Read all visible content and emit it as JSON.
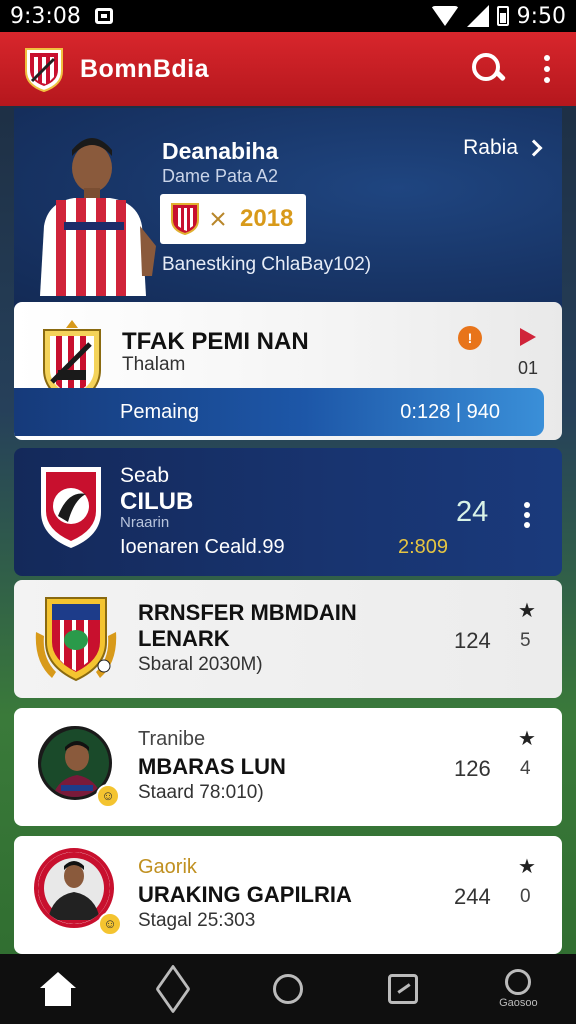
{
  "status_bar": {
    "time_left": "9:3:08",
    "time_right": "9:50"
  },
  "app_bar": {
    "title": "BomnBdia",
    "logo_icon": "club-crest-icon",
    "search_icon": "search-icon",
    "menu_icon": "more-vert-icon"
  },
  "hero": {
    "name": "Deanabiha",
    "subtitle": "Dame Pata A2",
    "badge_year": "2018",
    "stat": "Banestking ChlaBay102)",
    "link_label": "Rabia"
  },
  "cards": [
    {
      "title": "TFAK PEMI NAN",
      "subtitle": "Thalam",
      "bar_label": "Pemaing",
      "bar_value": "0:128 | 940",
      "num": "01"
    },
    {
      "line1": "Seab",
      "line2": "CILUB",
      "line3": "Nraarin",
      "line4": "Ioenaren Ceald.99",
      "num": "24",
      "value": "2:809"
    },
    {
      "line1": "RRNSFER MBMDAIN",
      "line2": "LENARK",
      "foot": "Sbaral 2030M)",
      "num": "124",
      "sec": "5"
    },
    {
      "pre": "Tranibe",
      "main": "MBARAS LUN",
      "foot": "Staard 78:010)",
      "num": "126",
      "sec": "4"
    },
    {
      "pre": "Gaorik",
      "main": "URAKING GAPILRIA",
      "foot": "Stagal 25:303",
      "num": "244",
      "sec": "0"
    }
  ],
  "nav": {
    "items": [
      {
        "icon": "home-icon"
      },
      {
        "icon": "back-triangle-icon"
      },
      {
        "icon": "circle-icon"
      },
      {
        "icon": "edit-square-icon"
      },
      {
        "icon": "account-icon",
        "label": "Gaosoo"
      }
    ]
  },
  "colors": {
    "brand_red": "#d8262c",
    "navy": "#183567",
    "accent_gold": "#d89a1a"
  }
}
